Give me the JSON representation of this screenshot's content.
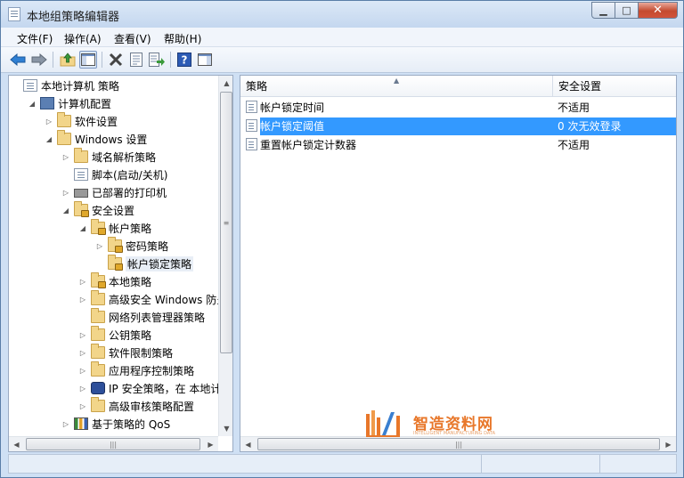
{
  "window": {
    "title": "本地组策略编辑器",
    "buttons": {
      "minimize": "▁",
      "maximize": "□",
      "close": "✕"
    }
  },
  "menubar": {
    "items": [
      {
        "label": "文件(F)"
      },
      {
        "label": "操作(A)"
      },
      {
        "label": "查看(V)"
      },
      {
        "label": "帮助(H)"
      }
    ]
  },
  "toolbar": {
    "icons": [
      "back-arrow-icon",
      "forward-arrow-icon",
      "up-folder-icon",
      "show-hide-tree-icon",
      "delete-icon",
      "properties-icon",
      "export-list-icon",
      "help-icon",
      "show-hide-action-pane-icon"
    ]
  },
  "tree": {
    "items": [
      {
        "label": "本地计算机 策略",
        "icon": "policy-doc-icon",
        "expander": ""
      },
      {
        "label": "计算机配置",
        "icon": "computer-icon",
        "expander": "◢"
      },
      {
        "label": "软件设置",
        "icon": "folder-icon",
        "expander": "▷"
      },
      {
        "label": "Windows 设置",
        "icon": "folder-icon",
        "expander": "◢"
      },
      {
        "label": "域名解析策略",
        "icon": "folder-icon",
        "expander": "▷"
      },
      {
        "label": "脚本(启动/关机)",
        "icon": "script-icon",
        "expander": ""
      },
      {
        "label": "已部署的打印机",
        "icon": "printer-icon",
        "expander": "▷"
      },
      {
        "label": "安全设置",
        "icon": "security-folder-icon",
        "expander": "◢"
      },
      {
        "label": "帐户策略",
        "icon": "security-folder-icon",
        "expander": "◢"
      },
      {
        "label": "密码策略",
        "icon": "security-folder-icon",
        "expander": "▷"
      },
      {
        "label": "帐户锁定策略",
        "icon": "security-folder-icon",
        "expander": ""
      },
      {
        "label": "本地策略",
        "icon": "security-folder-icon",
        "expander": "▷"
      },
      {
        "label": "高级安全 Windows 防火墙",
        "icon": "folder-icon",
        "expander": "▷"
      },
      {
        "label": "网络列表管理器策略",
        "icon": "folder-icon",
        "expander": ""
      },
      {
        "label": "公钥策略",
        "icon": "folder-icon",
        "expander": "▷"
      },
      {
        "label": "软件限制策略",
        "icon": "folder-icon",
        "expander": "▷"
      },
      {
        "label": "应用程序控制策略",
        "icon": "folder-icon",
        "expander": "▷"
      },
      {
        "label": "IP 安全策略，在 本地计算机",
        "icon": "ipsec-icon",
        "expander": "▷"
      },
      {
        "label": "高级审核策略配置",
        "icon": "folder-icon",
        "expander": "▷"
      },
      {
        "label": "基于策略的 QoS",
        "icon": "qos-chart-icon",
        "expander": "▷"
      }
    ]
  },
  "list": {
    "columns": [
      {
        "label": "策略"
      },
      {
        "label": "安全设置"
      }
    ],
    "rows": [
      {
        "policy": "帐户锁定时间",
        "setting": "不适用"
      },
      {
        "policy": "帐户锁定阈值",
        "setting": "0 次无效登录",
        "selected": true
      },
      {
        "policy": "重置帐户锁定计数器",
        "setting": "不适用"
      }
    ]
  },
  "watermark": {
    "text": "智造资料网",
    "sub": "INTELLIGENT MANUFACTURING DATA"
  },
  "colors": {
    "selection": "#3399ff",
    "window_frame": "#cfe0f4",
    "watermark": "#e8772a"
  }
}
